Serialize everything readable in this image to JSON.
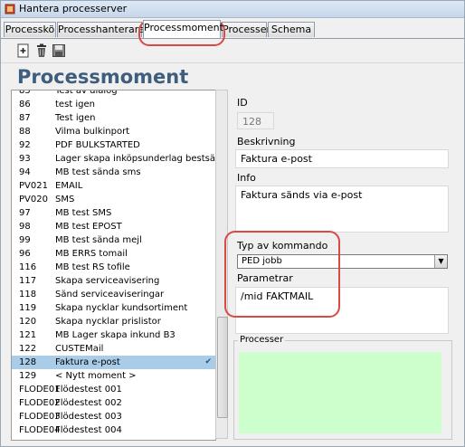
{
  "window": {
    "title": "Hantera processerver"
  },
  "tabs": [
    {
      "label": "Processkö"
    },
    {
      "label": "Processhanterare"
    },
    {
      "label": "Processmoment"
    },
    {
      "label": "Processer"
    },
    {
      "label": "Schema"
    }
  ],
  "toolbar": {
    "icons": [
      "add-icon",
      "delete-icon",
      "save-icon"
    ]
  },
  "section": {
    "title": "Processmoment"
  },
  "list": {
    "items": [
      {
        "code": "85",
        "name": "Test av dialog"
      },
      {
        "code": "86",
        "name": "test igen"
      },
      {
        "code": "87",
        "name": "Test igen"
      },
      {
        "code": "88",
        "name": "Vilma bulkinport"
      },
      {
        "code": "92",
        "name": "PDF BULKSTARTED"
      },
      {
        "code": "93",
        "name": "Lager skapa inköpsunderlag bestsätt"
      },
      {
        "code": "94",
        "name": "MB test sända sms"
      },
      {
        "code": "PV021",
        "name": "EMAIL"
      },
      {
        "code": "PV020",
        "name": "SMS"
      },
      {
        "code": "97",
        "name": "MB test SMS"
      },
      {
        "code": "98",
        "name": "MB test EPOST"
      },
      {
        "code": "99",
        "name": "MB test sända mejl"
      },
      {
        "code": "96",
        "name": "MB ERRS tomail"
      },
      {
        "code": "116",
        "name": "MB test RS tofile"
      },
      {
        "code": "117",
        "name": "Skapa serviceavisering"
      },
      {
        "code": "118",
        "name": "Sänd serviceaviseringar"
      },
      {
        "code": "119",
        "name": "Skapa nycklar kundsortiment"
      },
      {
        "code": "120",
        "name": "Skapa nycklar prislistor"
      },
      {
        "code": "121",
        "name": "MB Lager skapa inkund B3"
      },
      {
        "code": "122",
        "name": "CUSTEMail"
      },
      {
        "code": "128",
        "name": "Faktura  e-post",
        "selected": true
      },
      {
        "code": "129",
        "name": "< Nytt moment >"
      },
      {
        "code": "FLODE01",
        "name": "Flödestest 001"
      },
      {
        "code": "FLODE02",
        "name": "Flödestest 002"
      },
      {
        "code": "FLODE03",
        "name": "Flödestest 003"
      },
      {
        "code": "FLODE04",
        "name": "Flödestest 004"
      }
    ]
  },
  "form": {
    "id_label": "ID",
    "id_value": "128",
    "beskrivning_label": "Beskrivning",
    "beskrivning_value": "Faktura  e-post",
    "info_label": "Info",
    "info_value": "Faktura sänds via e-post",
    "typ_label": "Typ av kommando",
    "typ_value": "PED jobb",
    "parametrar_label": "Parametrar",
    "parametrar_value": "/mid FAKTMAIL",
    "processer_label": "Processer"
  },
  "colors": {
    "accent_title": "#3f5d7c",
    "selection": "#a9cde8",
    "annotation": "#d94a43",
    "processer_area": "#ccffcc"
  }
}
